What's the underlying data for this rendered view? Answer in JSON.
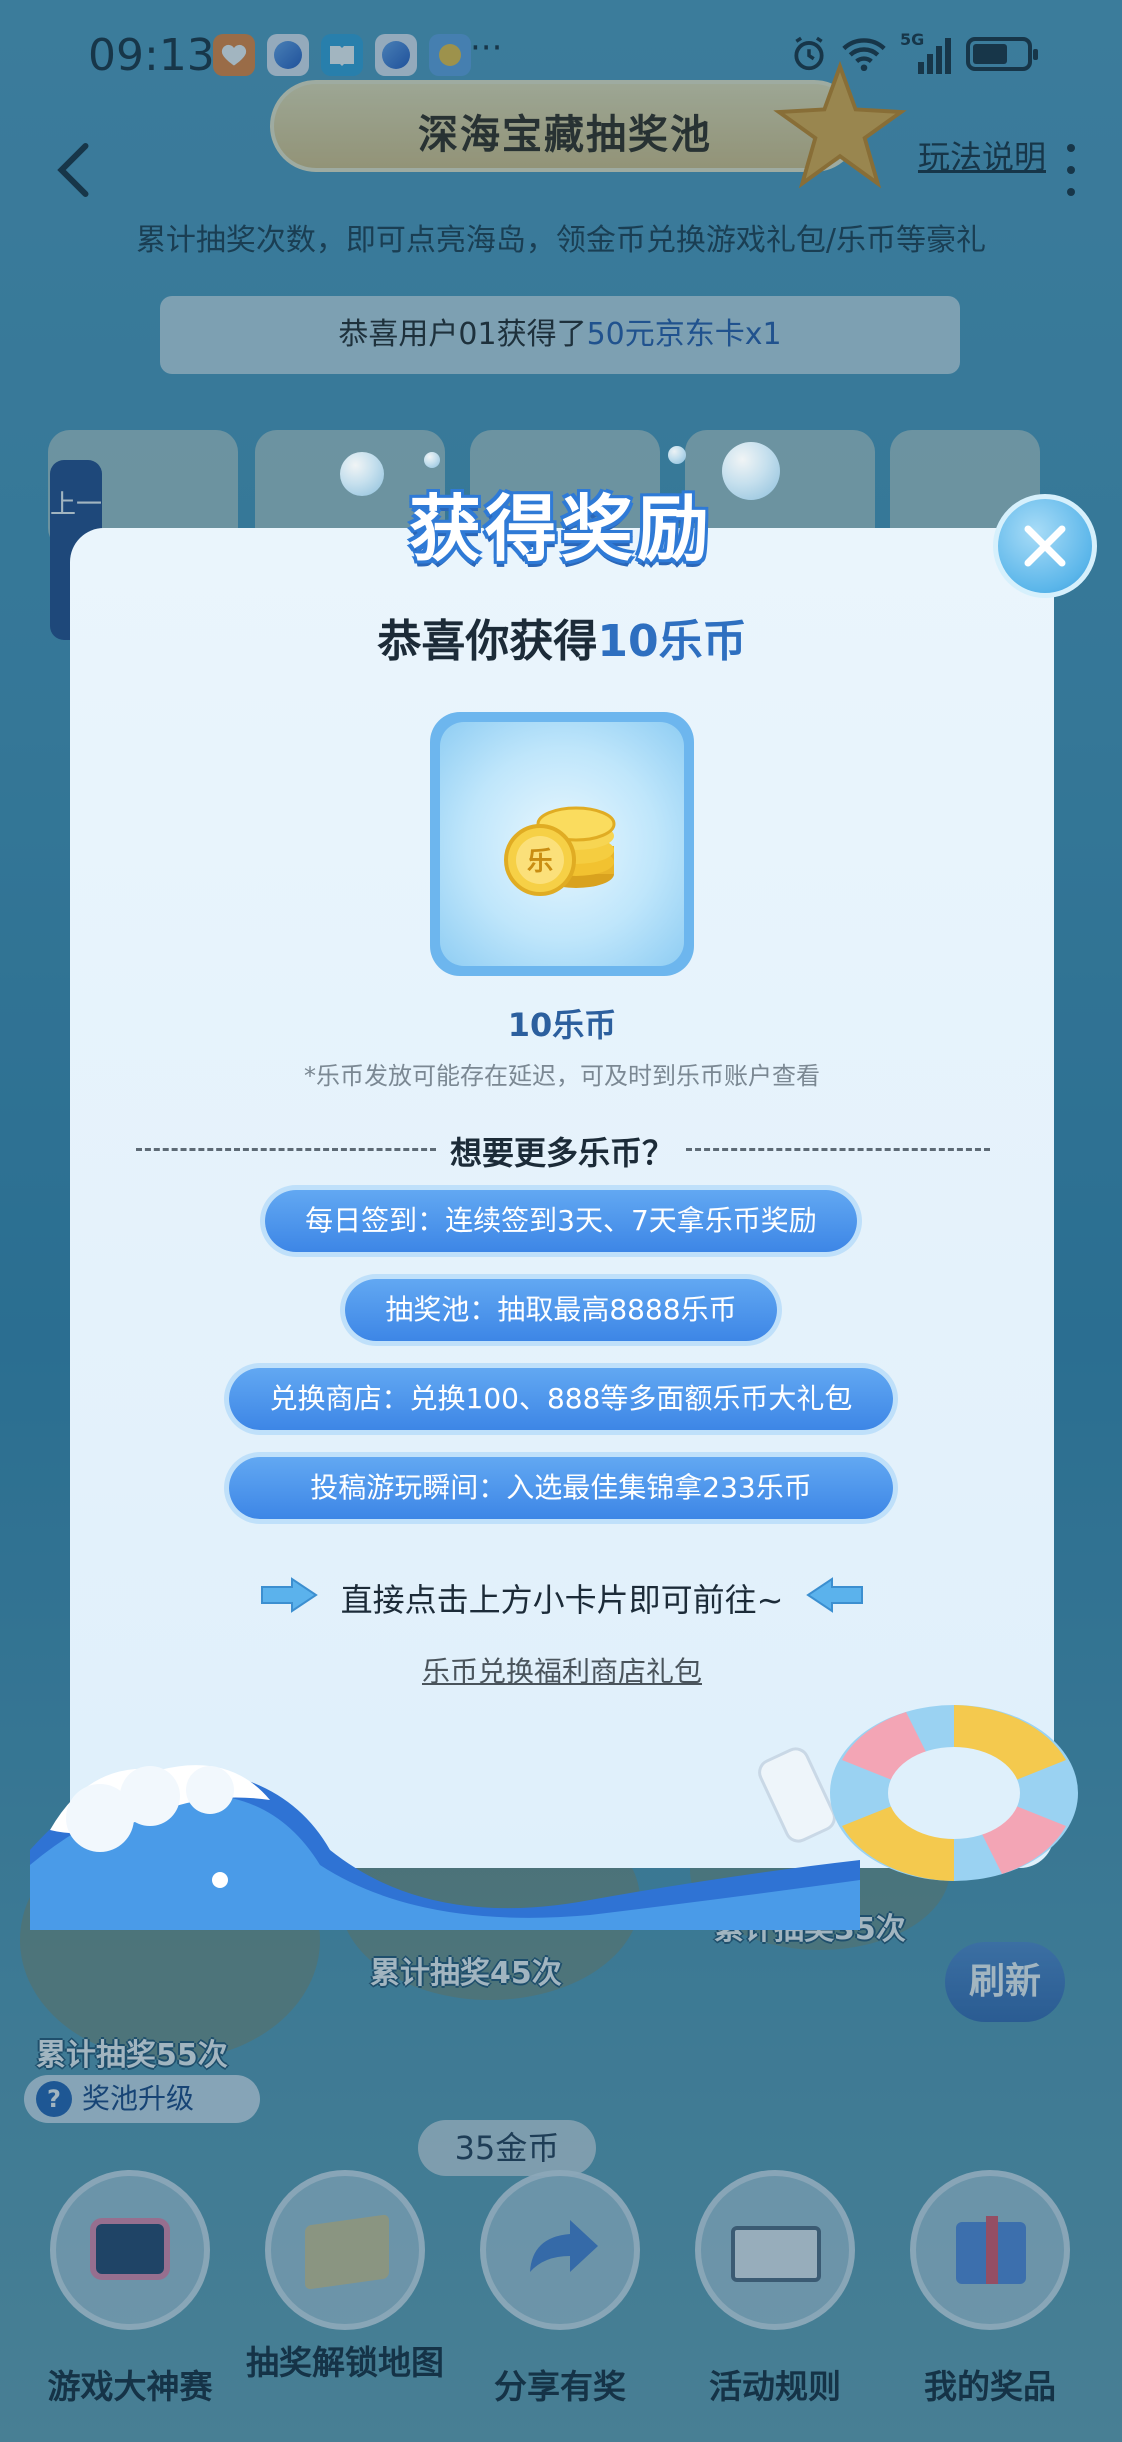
{
  "status_bar": {
    "time": "09:13",
    "more": "···",
    "network": "5G"
  },
  "header": {
    "title": "深海宝藏抽奖池",
    "rules_link": "玩法说明",
    "subtitle": "累计抽奖次数，即可点亮海岛，领金币兑换游戏礼包/乐币等豪礼"
  },
  "winner": {
    "prefix": "恭喜用户01获得了",
    "prize": "50元京东卡x1"
  },
  "side_tab": "上一",
  "modal": {
    "title": "获得奖励",
    "congrats_prefix": "恭喜你获得",
    "congrats_prize": "10乐币",
    "prize_name": "10乐币",
    "prize_coin_char": "乐",
    "note": "*乐币发放可能存在延迟，可及时到乐币账户查看",
    "more_title": "想要更多乐币？",
    "tips": [
      "每日签到：连续签到3天、7天拿乐币奖励",
      "抽奖池：抽取最高8888乐币",
      "兑换商店：兑换100、888等多面额乐币大礼包",
      "投稿游玩瞬间：入选最佳集锦拿233乐币"
    ],
    "go_hint": "直接点击上方小卡片即可前往~",
    "shop_link": "乐币兑换福利商店礼包"
  },
  "background": {
    "island_labels": [
      "累计抽奖55次",
      "累计抽奖45次",
      "累计抽奖35次"
    ],
    "pool_upgrade": "奖池升级",
    "refresh": "刷新",
    "coins": "35金币"
  },
  "bottom_nav": [
    {
      "label": "游戏大神赛",
      "icon": "tv-icon"
    },
    {
      "label": "抽奖解锁地图",
      "icon": "map-icon"
    },
    {
      "label": "分享有奖",
      "icon": "share-icon"
    },
    {
      "label": "活动规则",
      "icon": "book-icon"
    },
    {
      "label": "我的奖品",
      "icon": "gift-icon"
    }
  ],
  "colors": {
    "accent_blue": "#3d86e6",
    "highlight_text": "#2e6fc0",
    "coin_gold": "#f2c230"
  }
}
